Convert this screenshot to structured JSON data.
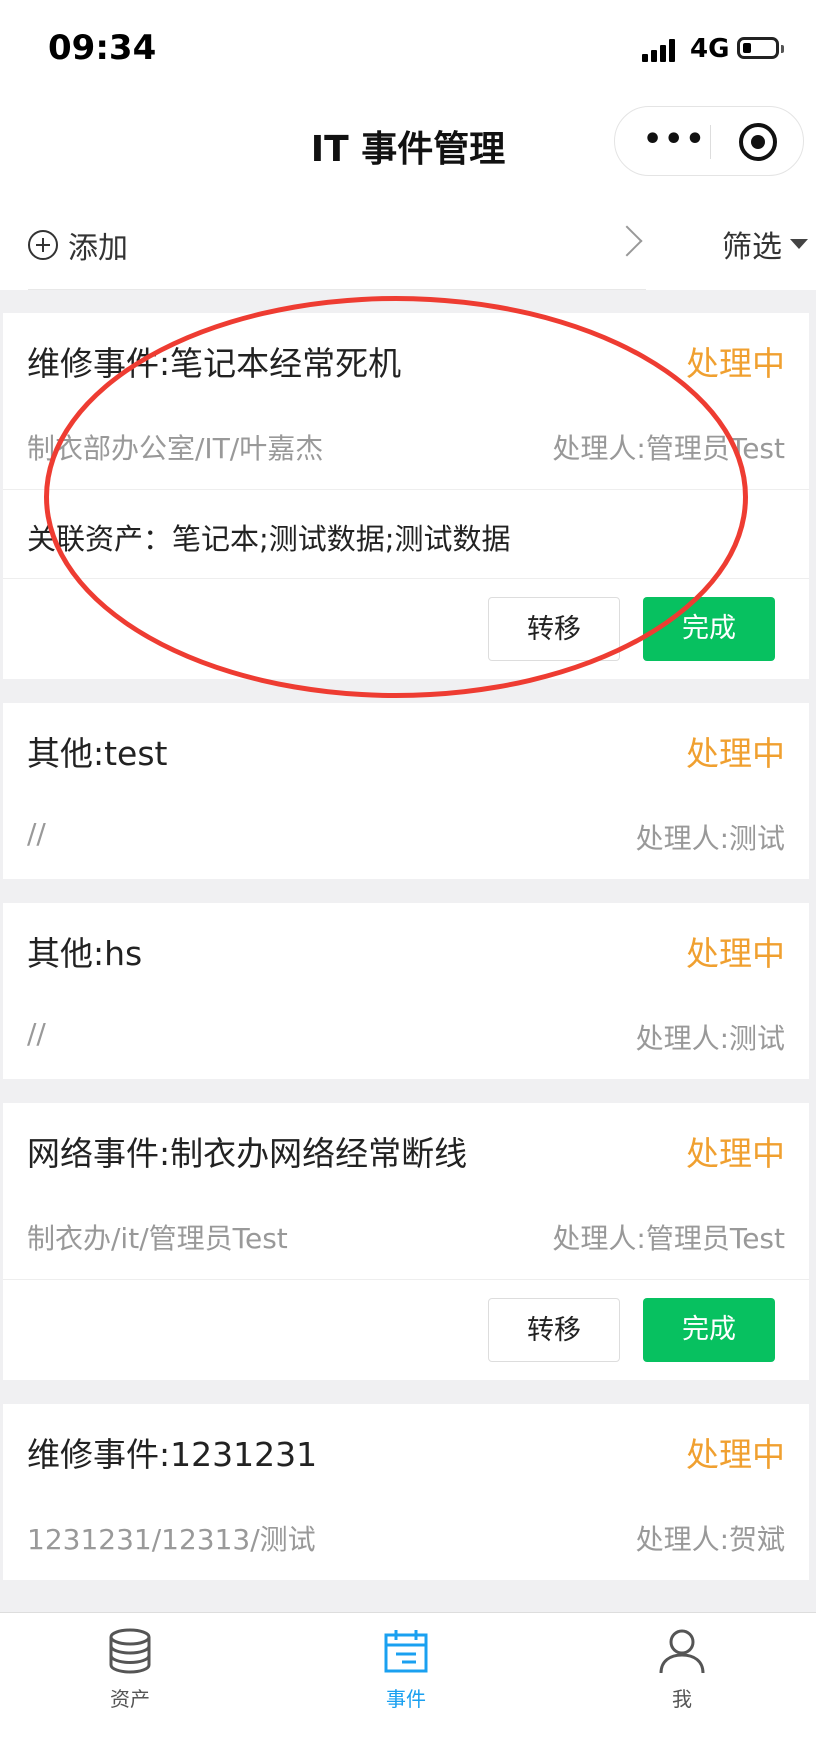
{
  "status_bar": {
    "time": "09:34",
    "network": "4G"
  },
  "nav": {
    "title": "IT 事件管理"
  },
  "toolbar": {
    "add_label": "添加",
    "filter_label": "筛选"
  },
  "events": [
    {
      "title": "维修事件:笔记本经常死机",
      "status": "处理中",
      "location": "制衣部办公室/IT/叶嘉杰",
      "handler": "处理人:管理员Test",
      "assets": "关联资产：笔记本;测试数据;测试数据",
      "transfer_label": "转移",
      "done_label": "完成"
    },
    {
      "title": "其他:test",
      "status": "处理中",
      "location": "//",
      "handler": "处理人:测试"
    },
    {
      "title": "其他:hs",
      "status": "处理中",
      "location": "//",
      "handler": "处理人:测试"
    },
    {
      "title": "网络事件:制衣办网络经常断线",
      "status": "处理中",
      "location": "制衣办/it/管理员Test",
      "handler": "处理人:管理员Test",
      "transfer_label": "转移",
      "done_label": "完成"
    },
    {
      "title": "维修事件:1231231",
      "status": "处理中",
      "location": "1231231/12313/测试",
      "handler": "处理人:贺斌"
    }
  ],
  "tabbar": {
    "items": [
      {
        "label": "资产",
        "icon": "database-icon",
        "active": false
      },
      {
        "label": "事件",
        "icon": "calendar-icon",
        "active": true
      },
      {
        "label": "我",
        "icon": "user-icon",
        "active": false
      }
    ]
  },
  "colors": {
    "status": "#f0a030",
    "done": "#07c160",
    "tab_active": "#1aa0f0",
    "tab_inactive": "#555555",
    "annotation": "#ee3c32"
  }
}
